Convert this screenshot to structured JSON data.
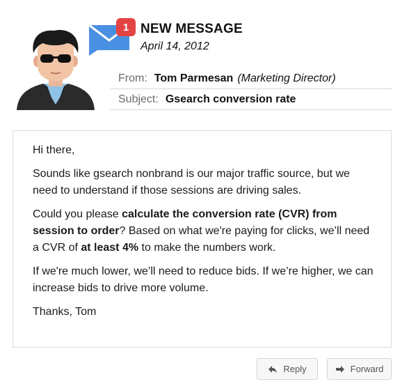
{
  "header": {
    "title": "NEW MESSAGE",
    "date": "April 14, 2012",
    "badge_count": "1"
  },
  "meta": {
    "from_label": "From:",
    "from_name": "Tom Parmesan",
    "from_role": "(Marketing Director)",
    "subject_label": "Subject:",
    "subject_value": "Gsearch conversion rate"
  },
  "body": {
    "greeting": "Hi there,",
    "p1": "Sounds like gsearch nonbrand is our major traffic source, but we need to understand if those sessions are driving sales.",
    "p2_pre": "Could you please ",
    "p2_bold1": "calculate the conversion rate (CVR) from session to order",
    "p2_mid": "? Based on what we're paying for clicks, we’ll need a CVR of ",
    "p2_bold2": "at least 4%",
    "p2_post": " to make the numbers work.",
    "p3": "If we're much lower, we’ll need to reduce bids. If we’re higher, we can increase bids to drive more volume.",
    "signoff": "Thanks, Tom"
  },
  "actions": {
    "reply_label": "Reply",
    "forward_label": "Forward"
  },
  "icons": {
    "avatar": "avatar-sunglasses-man",
    "mail": "envelope-icon",
    "reply": "reply-arrow-icon",
    "forward": "forward-arrow-icon"
  },
  "colors": {
    "envelope": "#4a90e2",
    "badge": "#e34443"
  }
}
